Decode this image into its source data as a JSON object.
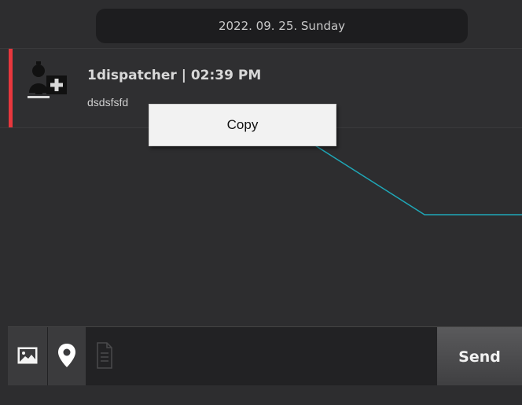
{
  "header": {
    "date_label": "2022. 09. 25. Sunday"
  },
  "message": {
    "sender": "1dispatcher | 02:39 PM",
    "text": "dsdsfsfd",
    "avatar_icon": "user-add-icon",
    "unread_indicator_color": "#e8373d"
  },
  "context_menu": {
    "copy_label": "Copy"
  },
  "composer": {
    "image_icon": "image-icon",
    "location_icon": "location-pin-icon",
    "file_icon": "document-icon",
    "input_value": "",
    "send_label": "Send"
  },
  "colors": {
    "background": "#2d2d2f",
    "pointer_line": "#1fa8b8"
  }
}
